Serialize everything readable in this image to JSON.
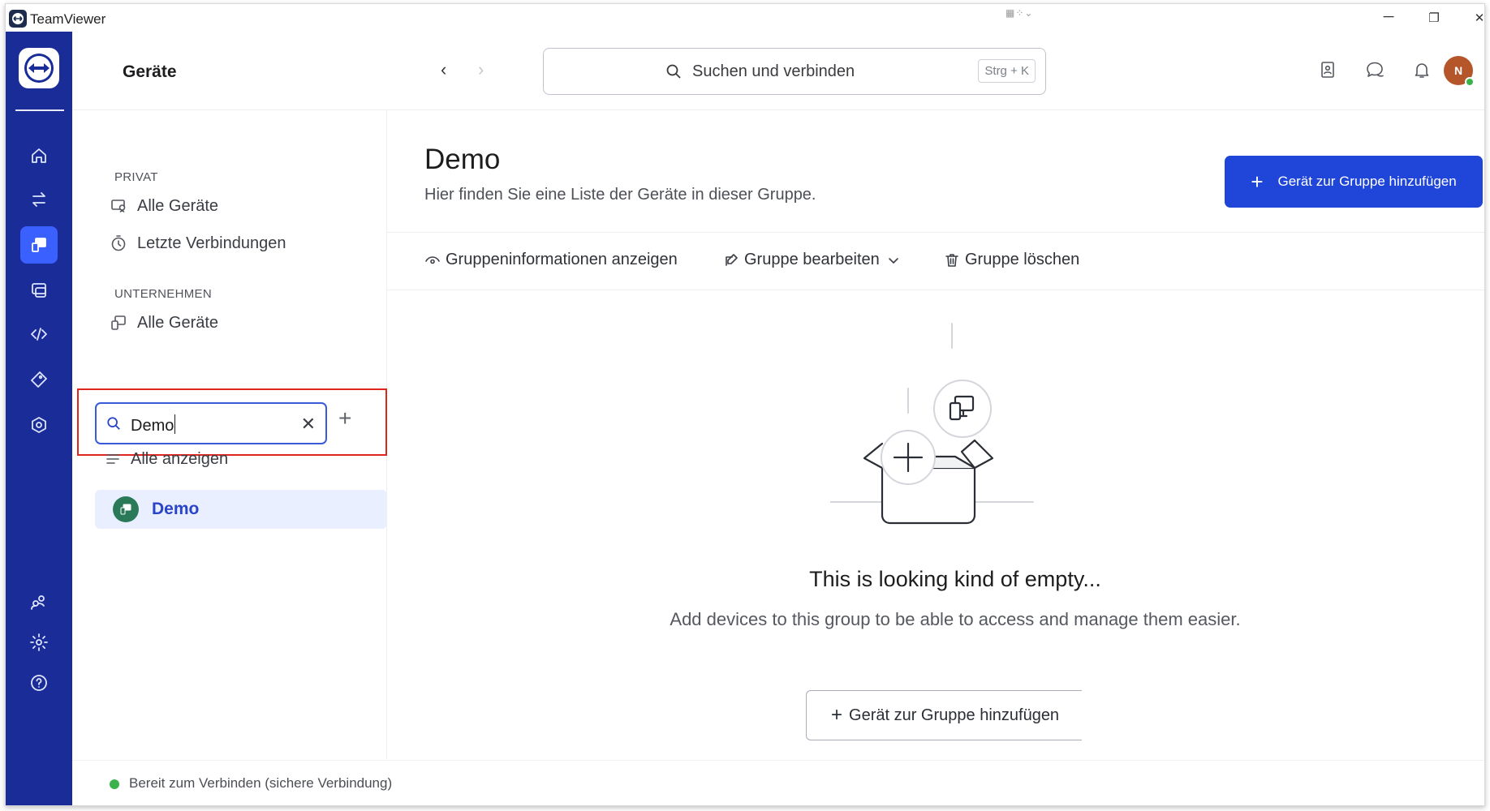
{
  "window": {
    "app_title": "TeamViewer",
    "minimize": "─",
    "restore": "❐",
    "close": "✕"
  },
  "header": {
    "title": "Geräte",
    "search": {
      "placeholder": "Suchen und verbinden",
      "shortcut": "Strg + K"
    },
    "avatar_initial": "N"
  },
  "sidebar": {
    "private_label": "PRIVAT",
    "private_items": [
      {
        "label": "Alle Geräte",
        "icon": "devices-icon"
      },
      {
        "label": "Letzte Verbindungen",
        "icon": "clock-icon"
      }
    ],
    "company_label": "UNTERNEHMEN",
    "company_items": [
      {
        "label": "Alle Geräte",
        "icon": "devices-icon"
      }
    ],
    "filter": {
      "value": "Demo"
    },
    "show_all_label": "Alle anzeigen",
    "groups": [
      {
        "label": "Demo",
        "selected": true
      }
    ]
  },
  "main": {
    "title": "Demo",
    "subtitle": "Hier finden Sie eine Liste der Geräte in dieser Gruppe.",
    "primary_button": "Gerät zur Gruppe hinzufügen",
    "actions": {
      "info": "Gruppeninformationen anzeigen",
      "edit": "Gruppe bearbeiten",
      "delete": "Gruppe löschen"
    },
    "empty": {
      "title": "This is looking kind of empty...",
      "description": "Add devices to this group to be able to access and manage them easier.",
      "button": "Gerät zur Gruppe hinzufügen"
    }
  },
  "status": {
    "text": "Bereit zum Verbinden (sichere Verbindung)",
    "color": "#3bb34a"
  },
  "colors": {
    "rail": "#1a2c98",
    "accent": "#1f45d9",
    "selected_bg": "#eaefff",
    "highlight": "#e0251f"
  }
}
